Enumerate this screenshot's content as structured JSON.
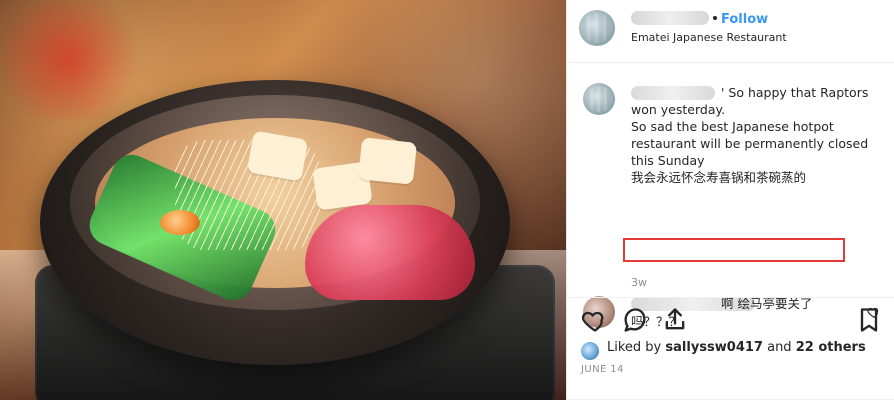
{
  "header": {
    "follow_label": "Follow",
    "location": "Ematei Japanese Restaurant"
  },
  "comments": {
    "main": {
      "line1_suffix": "' So happy that Raptors",
      "line2": "won yesterday.",
      "line3": "So sad the best Japanese hotpot",
      "line4": "restaurant will be permanently closed",
      "line5": "this Sunday",
      "line6": "我会永远怀念寿喜锅和茶碗蒸的",
      "time": "3w"
    },
    "reply": {
      "line1": "啊 绘马亭要关了",
      "line2": "吗？？？"
    }
  },
  "footer": {
    "liked_by_prefix": "Liked by ",
    "liked_by_user": "sallyssw0417",
    "liked_by_mid": " and ",
    "liked_by_count": "22 others",
    "date": "JUNE 14"
  },
  "icons": {
    "heart": "heart-icon",
    "comment": "comment-icon",
    "share": "share-icon",
    "save": "bookmark-icon"
  },
  "colors": {
    "follow": "#3897f0",
    "highlight_border": "#e53935"
  }
}
